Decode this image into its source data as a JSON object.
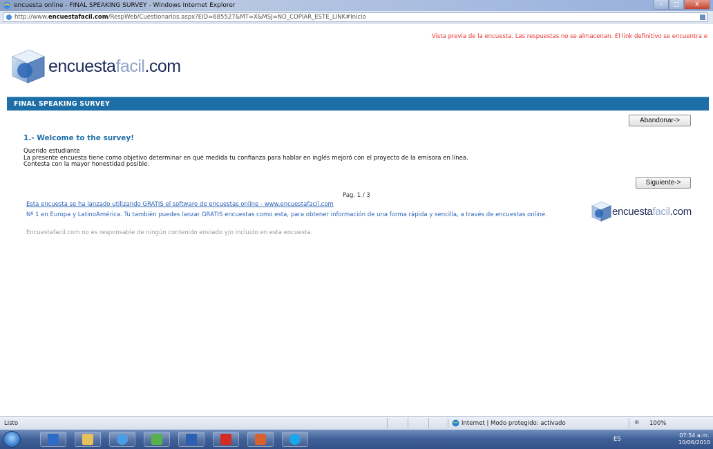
{
  "window": {
    "title": "encuesta online - FINAL SPEAKING SURVEY - Windows Internet Explorer",
    "controls": {
      "minimize": "–",
      "maximize": "□",
      "close": "X"
    }
  },
  "address": {
    "url_prefix": "http://www.",
    "url_domain": "encuestafacil.com",
    "url_rest": "/RespWeb/Cuestionarios.aspx?EID=685527&MT=X&MSJ=NO_COPIAR_ESTE_LINK#Inicio"
  },
  "page": {
    "preview_notice": "Vista previa de la encuesta. Las respuestas no se almacenan. El link definitivo se encuentra e",
    "logo": {
      "dark": "encuesta",
      "light": "facil",
      "tld": ".com"
    },
    "survey_title": "FINAL SPEAKING SURVEY",
    "abandon_button": "Abandonar->",
    "next_button": "Siguiente->",
    "question_title": "1.- Welcome to the survey!",
    "question_lines": [
      "Querido estudiante",
      "La presente encuesta tiene como objetivo determinar en qué medida tu confianza para hablar en inglés mejoró con el proyecto de la emisora en línea.",
      "Contesta con la mayor honestidad posible."
    ],
    "page_indicator": "Pag. 1 / 3",
    "footer_link": "Esta encuesta se ha lanzado utilizando GRATIS el software de encuestas online - www.encuestafacil.com",
    "footer_note": "Nº 1 en Europa y LatinoAmérica. Tu también puedes lanzar GRATIS encuestas como esta, para obtener información de una forma rápida y sencilla, a través de encuestas online.",
    "footer_disclaimer": "Encuestafacil.com no es responsable de ningún contenido enviado y/o incluido en esta encuesta.",
    "side_logo": {
      "dark": "encuesta",
      "light": "facil",
      "tld": ".com"
    }
  },
  "statusbar": {
    "status": "Listo",
    "zone": "Internet | Modo protegido: activado",
    "zoom": "100%",
    "zoom_icon": "⊕"
  },
  "taskbar": {
    "apps": [
      {
        "name": "media-player-icon",
        "color": "#2d6cc9"
      },
      {
        "name": "folder-icon",
        "color": "#e6c25a"
      },
      {
        "name": "internet-explorer-icon",
        "color": "#4a9ee8"
      },
      {
        "name": "messenger-icon",
        "color": "#58b04c"
      },
      {
        "name": "word-icon",
        "color": "#2b5fb3"
      },
      {
        "name": "acrobat-icon",
        "color": "#d42b22"
      },
      {
        "name": "powerpoint-icon",
        "color": "#d9612d"
      },
      {
        "name": "skype-icon",
        "color": "#1aa6e8"
      }
    ],
    "language": "ES",
    "time": "07:54 a.m.",
    "date": "10/06/2010"
  },
  "colors": {
    "survey_bar": "#1e6fa8",
    "link": "#2d63b8",
    "notice": "#e8312b"
  }
}
